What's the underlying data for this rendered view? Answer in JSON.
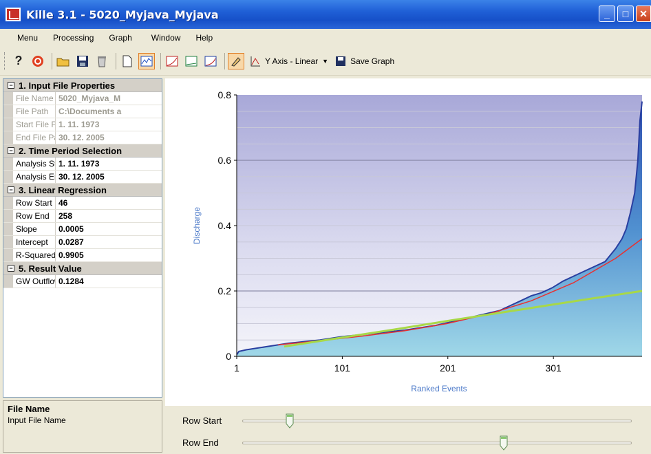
{
  "window": {
    "title": "Kille 3.1 - 5020_Myjava_Myjava"
  },
  "menu": [
    "Menu",
    "Processing",
    "Graph",
    "Window",
    "Help"
  ],
  "toolbar": {
    "y_axis_label": "Y Axis - Linear",
    "save_label": "Save Graph"
  },
  "properties": {
    "cat1": "1. Input File Properties",
    "file_name_k": "File Name",
    "file_name_v": "5020_Myjava_M",
    "file_path_k": "File Path",
    "file_path_v": "C:\\Documents a",
    "start_k": "Start File Pa",
    "start_v": "1. 11. 1973",
    "end_k": "End File Pat",
    "end_v": "30. 12. 2005",
    "cat2": "2. Time Period Selection",
    "astart_k": "Analysis Sta",
    "astart_v": "1. 11. 1973",
    "aend_k": "Analysis End",
    "aend_v": "30. 12. 2005",
    "cat3": "3. Linear Regression",
    "rowstart_k": "Row Start",
    "rowstart_v": "46",
    "rowend_k": "Row End",
    "rowend_v": "258",
    "slope_k": "Slope",
    "slope_v": "0.0005",
    "intercept_k": "Intercept",
    "intercept_v": "0.0287",
    "rsq_k": "R-Squared",
    "rsq_v": "0.9905",
    "cat5": "5. Result Value",
    "gw_k": "GW Outflow",
    "gw_v": "0.1284"
  },
  "description": {
    "title": "File Name",
    "text": "Input File Name"
  },
  "sliders": {
    "row_start_label": "Row Start",
    "row_end_label": "Row End",
    "row_start_frac": 0.12,
    "row_end_frac": 0.67
  },
  "chart_data": {
    "type": "line",
    "xlabel": "Ranked Events",
    "ylabel": "Discharge",
    "xlim": [
      1,
      385
    ],
    "ylim": [
      0,
      0.8
    ],
    "x_ticks": [
      "1",
      "101",
      "201",
      "301"
    ],
    "x_tick_values": [
      1,
      101,
      201,
      301
    ],
    "y_ticks": [
      "0",
      "0.2",
      "0.4",
      "0.6",
      "0.8"
    ],
    "y_tick_values": [
      0,
      0.2,
      0.4,
      0.6,
      0.8
    ],
    "series": [
      {
        "color": "#2a3fa0",
        "x": [
          1,
          3,
          10,
          30,
          50,
          80,
          100,
          130,
          160,
          190,
          210,
          230,
          250,
          260,
          270,
          280,
          290,
          300,
          310,
          320,
          330,
          340,
          350,
          360,
          366,
          370,
          374,
          378,
          381,
          383,
          385
        ],
        "values": [
          0.005,
          0.015,
          0.02,
          0.03,
          0.04,
          0.05,
          0.06,
          0.07,
          0.08,
          0.095,
          0.11,
          0.125,
          0.14,
          0.155,
          0.17,
          0.185,
          0.195,
          0.21,
          0.23,
          0.245,
          0.26,
          0.275,
          0.29,
          0.33,
          0.36,
          0.39,
          0.44,
          0.5,
          0.6,
          0.72,
          0.78
        ]
      },
      {
        "color": "#e83030",
        "x": [
          40,
          80,
          120,
          160,
          200,
          240,
          280,
          320,
          360,
          385
        ],
        "values": [
          0.035,
          0.048,
          0.062,
          0.078,
          0.1,
          0.13,
          0.17,
          0.225,
          0.3,
          0.36
        ]
      },
      {
        "color": "#a8d848",
        "x": [
          46,
          100,
          150,
          200,
          258,
          300,
          340,
          385
        ],
        "values": [
          0.03,
          0.057,
          0.082,
          0.108,
          0.137,
          0.158,
          0.178,
          0.2
        ]
      }
    ]
  }
}
